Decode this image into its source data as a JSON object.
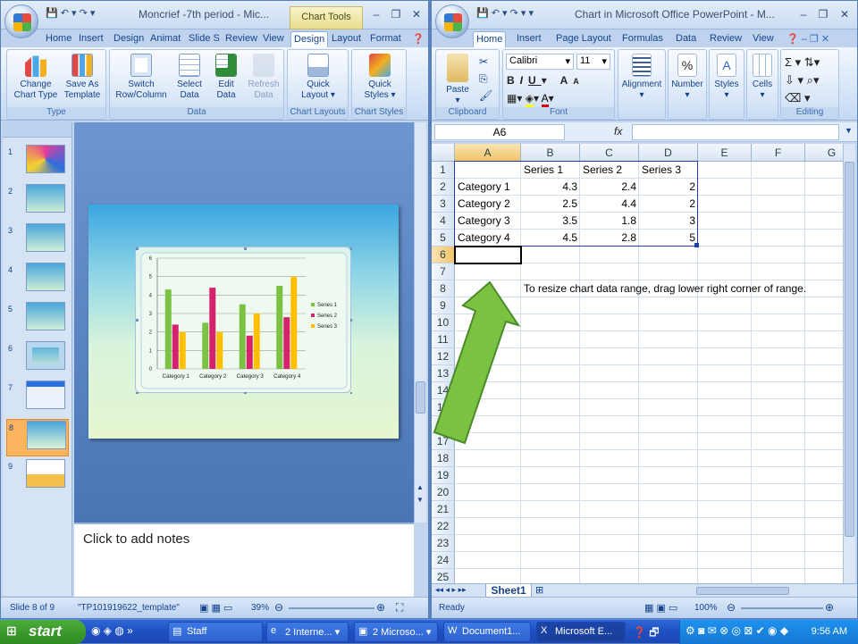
{
  "powerpoint": {
    "title": "Moncrief -7th period - Mic...",
    "context_tab": "Chart Tools",
    "tabs": [
      "Home",
      "Insert",
      "Design",
      "Animat",
      "Slide S",
      "Review",
      "View",
      "Design",
      "Layout",
      "Format"
    ],
    "active_tab": "Design",
    "groups": {
      "type": {
        "label": "Type",
        "buttons": [
          {
            "l1": "Change",
            "l2": "Chart Type"
          },
          {
            "l1": "Save As",
            "l2": "Template"
          }
        ]
      },
      "data": {
        "label": "Data",
        "buttons": [
          {
            "l1": "Switch",
            "l2": "Row/Column"
          },
          {
            "l1": "Select",
            "l2": "Data"
          },
          {
            "l1": "Edit",
            "l2": "Data"
          },
          {
            "l1": "Refresh",
            "l2": "Data"
          }
        ]
      },
      "layouts": {
        "label": "Chart Layouts",
        "button_l1": "Quick",
        "button_l2": "Layout ▾"
      },
      "styles": {
        "label": "Chart Styles",
        "button_l1": "Quick",
        "button_l2": "Styles ▾"
      }
    },
    "slides": [
      "1",
      "2",
      "3",
      "4",
      "5",
      "6",
      "7",
      "8",
      "9"
    ],
    "selected_slide": "8",
    "notes_placeholder": "Click to add notes",
    "status": {
      "slide": "Slide 8 of 9",
      "template": "\"TP101919622_template\"",
      "zoom": "39%"
    }
  },
  "excel": {
    "title": "Chart in Microsoft Office PowerPoint - M...",
    "tabs": [
      "Home",
      "Insert",
      "Page Layout",
      "Formulas",
      "Data",
      "Review",
      "View"
    ],
    "active_tab": "Home",
    "font_name": "Calibri",
    "font_size": "11",
    "groups": {
      "clipboard": "Clipboard",
      "font": "Font",
      "alignment": "Alignment",
      "number": "Number",
      "styles": "Styles",
      "cells": "Cells",
      "editing": "Editing"
    },
    "paste_label": "Paste",
    "name_box": "A6",
    "fx": "fx",
    "columns": [
      "A",
      "B",
      "C",
      "D",
      "E",
      "F",
      "G"
    ],
    "rows": [
      "1",
      "2",
      "3",
      "4",
      "5",
      "6",
      "7",
      "8",
      "9",
      "10",
      "11",
      "12",
      "13",
      "14",
      "15",
      "16",
      "17",
      "18",
      "19",
      "20",
      "21",
      "22",
      "23",
      "24",
      "25"
    ],
    "headers": [
      "Series 1",
      "Series 2",
      "Series 3"
    ],
    "data_rows": [
      {
        "cat": "Category 1",
        "v": [
          "4.3",
          "2.4",
          "2"
        ]
      },
      {
        "cat": "Category 2",
        "v": [
          "2.5",
          "4.4",
          "2"
        ]
      },
      {
        "cat": "Category 3",
        "v": [
          "3.5",
          "1.8",
          "3"
        ]
      },
      {
        "cat": "Category 4",
        "v": [
          "4.5",
          "2.8",
          "5"
        ]
      }
    ],
    "note": "To resize chart data range, drag lower right corner of range.",
    "sheet_tab": "Sheet1",
    "status": {
      "ready": "Ready",
      "zoom": "100%"
    }
  },
  "chart_data": {
    "type": "bar",
    "categories": [
      "Category 1",
      "Category 2",
      "Category 3",
      "Category 4"
    ],
    "series": [
      {
        "name": "Series 1",
        "values": [
          4.3,
          2.5,
          3.5,
          4.5
        ],
        "color": "#7cc242"
      },
      {
        "name": "Series 2",
        "values": [
          2.4,
          4.4,
          1.8,
          2.8
        ],
        "color": "#d4236c"
      },
      {
        "name": "Series 3",
        "values": [
          2,
          2,
          3,
          5
        ],
        "color": "#ffc000"
      }
    ],
    "ylim": [
      0,
      6
    ],
    "yticks": [
      "0",
      "1",
      "2",
      "3",
      "4",
      "5",
      "6"
    ],
    "legend": "right"
  },
  "arrow_color": "#7cc242",
  "taskbar": {
    "start": "start",
    "items": [
      "Staff",
      "2 Interne...",
      "2 Microso...",
      "Document1...",
      "Microsoft E..."
    ],
    "clock": "9:56 AM"
  }
}
